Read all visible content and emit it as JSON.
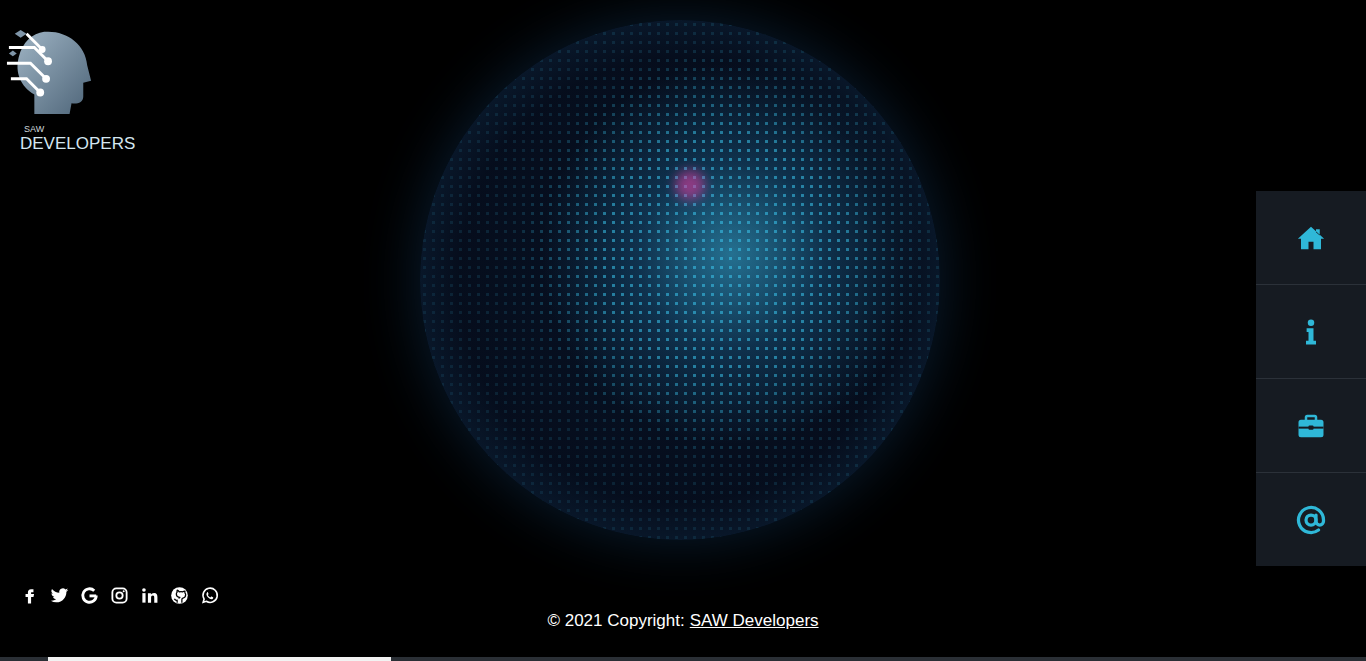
{
  "logo": {
    "small": "SAW",
    "name": "DEVELOPERS"
  },
  "nav": {
    "items": [
      {
        "kind": "home"
      },
      {
        "kind": "about"
      },
      {
        "kind": "portfolio"
      },
      {
        "kind": "contact"
      }
    ]
  },
  "social": [
    {
      "kind": "facebook"
    },
    {
      "kind": "twitter"
    },
    {
      "kind": "google"
    },
    {
      "kind": "instagram"
    },
    {
      "kind": "linkedin"
    },
    {
      "kind": "github"
    },
    {
      "kind": "whatsapp"
    }
  ],
  "footer": {
    "text": "© 2021 Copyright:",
    "link": "SAW Developers"
  },
  "progress": {
    "level": 0.251
  }
}
